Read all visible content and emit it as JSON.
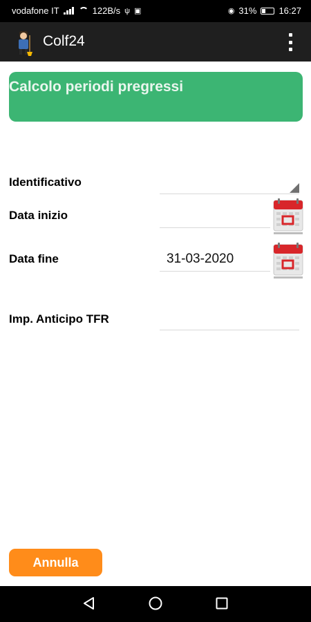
{
  "status_bar": {
    "carrier": "vodafone IT",
    "data_rate": "122B/s",
    "battery": "31%",
    "time": "16:27"
  },
  "app_bar": {
    "title": "Colf24",
    "logo_icon": "housekeeper-logo-icon",
    "menu_icon": "overflow-menu-icon"
  },
  "banner": {
    "title": "Calcolo periodi pregressi",
    "color": "#3cb573"
  },
  "form": {
    "identificativo_label": "Identificativo",
    "identificativo_value": "",
    "data_inizio_label": "Data inizio",
    "data_inizio_value": "",
    "data_fine_label": "Data fine",
    "data_fine_value": "31-03-2020",
    "tfr_label": "Imp. Anticipo TFR",
    "tfr_value": ""
  },
  "actions": {
    "cancel_label": "Annulla",
    "cancel_color": "#ff8c1a"
  },
  "nav": {
    "back_icon": "back-icon",
    "home_icon": "home-icon",
    "recents_icon": "recents-icon"
  }
}
